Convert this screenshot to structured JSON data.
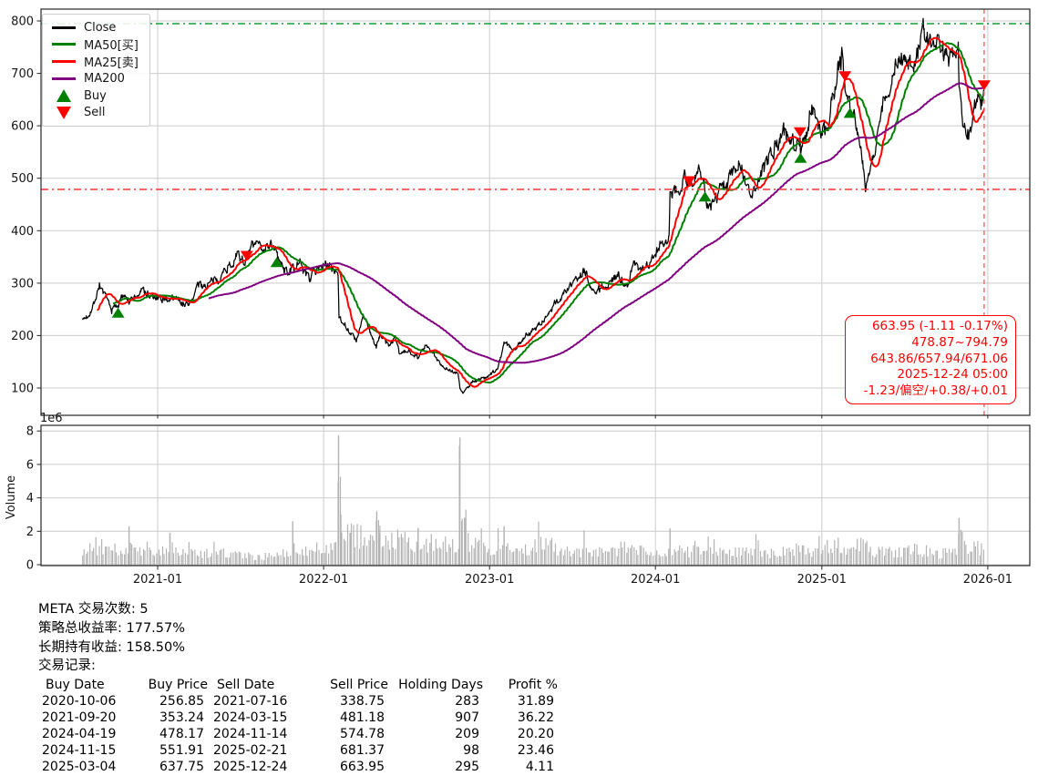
{
  "legend": {
    "items": [
      {
        "label": "Close",
        "type": "line",
        "color": "#000000"
      },
      {
        "label": "MA50[买]",
        "type": "line",
        "color": "#008000"
      },
      {
        "label": "MA25[卖]",
        "type": "line",
        "color": "#ff0000"
      },
      {
        "label": "MA200",
        "type": "line",
        "color": "#800080"
      },
      {
        "label": "Buy",
        "type": "triangle-up",
        "color": "#008000"
      },
      {
        "label": "Sell",
        "type": "triangle-down",
        "color": "#ff0000"
      }
    ]
  },
  "annotation": {
    "color": "#ff0000",
    "lines": [
      "663.95 (-1.11 -0.17%)",
      "478.87~794.79",
      "643.86/657.94/671.06",
      "2025-12-24 05:00",
      "-1.23/偏空/+0.38/+0.01"
    ]
  },
  "footer": {
    "stats": [
      "META 交易次数: 5",
      "策略总收益率: 177.57%",
      "长期持有收益: 158.50%",
      "交易记录:"
    ],
    "table": {
      "headers": [
        "Buy Date",
        "Buy Price",
        "Sell Date",
        "Sell Price",
        "Holding Days",
        "Profit %"
      ],
      "rows": [
        [
          "2020-10-06",
          "256.85",
          "2021-07-16",
          "338.75",
          "283",
          "31.89"
        ],
        [
          "2021-09-20",
          "353.24",
          "2024-03-15",
          "481.18",
          "907",
          "36.22"
        ],
        [
          "2024-04-19",
          "478.17",
          "2024-11-14",
          "574.78",
          "209",
          "20.20"
        ],
        [
          "2024-11-15",
          "551.91",
          "2025-02-21",
          "681.37",
          "98",
          "23.46"
        ],
        [
          "2025-03-04",
          "637.75",
          "2025-12-24",
          "663.95",
          "295",
          "4.11"
        ]
      ]
    }
  },
  "chart_data": {
    "type": "line",
    "title": "",
    "xlabel": "",
    "ylabel": "",
    "volume_axis_label": "Volume",
    "volume_offset_label": "1e6",
    "ylim": [
      48,
      823
    ],
    "volume_ylim": [
      0,
      8000000
    ],
    "xlim": [
      "2020-04-20",
      "2026-04-03"
    ],
    "grid": true,
    "legend_position": "upper left",
    "grid_color": "#cccccc",
    "x_ticks": [
      {
        "label": "2021-01",
        "date": "2021-01-01"
      },
      {
        "label": "2022-01",
        "date": "2022-01-01"
      },
      {
        "label": "2023-01",
        "date": "2023-01-01"
      },
      {
        "label": "2024-01",
        "date": "2024-01-01"
      },
      {
        "label": "2025-01",
        "date": "2025-01-01"
      },
      {
        "label": "2026-01",
        "date": "2026-01-01"
      }
    ],
    "price_ticks": [
      100,
      200,
      300,
      400,
      500,
      600,
      700,
      800
    ],
    "volume_ticks": [
      0,
      2,
      4,
      6,
      8
    ],
    "reference_lines": {
      "high": {
        "value": 794.79,
        "color": "#10a037",
        "style": "dashdot"
      },
      "low": {
        "value": 478.87,
        "color": "#ff4040",
        "style": "dashdot"
      },
      "current_date": {
        "value": "2025-12-24",
        "color": "#ff6060",
        "style": "dashed"
      }
    },
    "markers": {
      "buys": [
        {
          "date": "2020-10-06",
          "price": 256.85
        },
        {
          "date": "2021-09-20",
          "price": 353.24
        },
        {
          "date": "2024-04-19",
          "price": 478.17
        },
        {
          "date": "2024-11-15",
          "price": 551.91
        },
        {
          "date": "2025-03-04",
          "price": 637.75
        }
      ],
      "sells": [
        {
          "date": "2021-07-16",
          "price": 338.75
        },
        {
          "date": "2024-03-15",
          "price": 481.18
        },
        {
          "date": "2024-11-14",
          "price": 574.78
        },
        {
          "date": "2025-02-21",
          "price": 681.37
        },
        {
          "date": "2025-12-24",
          "price": 663.95
        }
      ]
    },
    "series": {
      "close": {
        "name": "Close",
        "color": "#000000",
        "points": [
          [
            "2020-07-20",
            230
          ],
          [
            "2020-07-31",
            238
          ],
          [
            "2020-08-14",
            262
          ],
          [
            "2020-08-26",
            299
          ],
          [
            "2020-09-04",
            282
          ],
          [
            "2020-09-21",
            248
          ],
          [
            "2020-10-06",
            259
          ],
          [
            "2020-10-23",
            284
          ],
          [
            "2020-10-30",
            263
          ],
          [
            "2020-11-16",
            276
          ],
          [
            "2020-12-01",
            286
          ],
          [
            "2020-12-18",
            272
          ],
          [
            "2021-01-08",
            268
          ],
          [
            "2021-01-27",
            272
          ],
          [
            "2021-02-17",
            269
          ],
          [
            "2021-03-08",
            254
          ],
          [
            "2021-03-31",
            295
          ],
          [
            "2021-04-22",
            298
          ],
          [
            "2021-05-12",
            305
          ],
          [
            "2021-06-01",
            328
          ],
          [
            "2021-06-28",
            352
          ],
          [
            "2021-07-16",
            341
          ],
          [
            "2021-07-27",
            372
          ],
          [
            "2021-08-27",
            370
          ],
          [
            "2021-09-07",
            380
          ],
          [
            "2021-09-20",
            353
          ],
          [
            "2021-10-04",
            326
          ],
          [
            "2021-10-22",
            324
          ],
          [
            "2021-11-09",
            337
          ],
          [
            "2021-12-01",
            311
          ],
          [
            "2021-12-23",
            334
          ],
          [
            "2022-01-14",
            332
          ],
          [
            "2022-02-02",
            323
          ],
          [
            "2022-02-04",
            238
          ],
          [
            "2022-02-25",
            211
          ],
          [
            "2022-03-14",
            188
          ],
          [
            "2022-03-29",
            234
          ],
          [
            "2022-04-08",
            222
          ],
          [
            "2022-04-27",
            175
          ],
          [
            "2022-05-06",
            204
          ],
          [
            "2022-05-24",
            181
          ],
          [
            "2022-06-08",
            196
          ],
          [
            "2022-06-17",
            163
          ],
          [
            "2022-07-08",
            171
          ],
          [
            "2022-07-28",
            160
          ],
          [
            "2022-08-15",
            180
          ],
          [
            "2022-09-06",
            156
          ],
          [
            "2022-09-30",
            136
          ],
          [
            "2022-10-24",
            129
          ],
          [
            "2022-10-28",
            99
          ],
          [
            "2022-11-04",
            90
          ],
          [
            "2022-11-23",
            111
          ],
          [
            "2022-12-13",
            119
          ],
          [
            "2022-12-29",
            120
          ],
          [
            "2023-01-20",
            140
          ],
          [
            "2023-02-02",
            188
          ],
          [
            "2023-02-24",
            171
          ],
          [
            "2023-03-17",
            196
          ],
          [
            "2023-04-14",
            218
          ],
          [
            "2023-05-05",
            233
          ],
          [
            "2023-05-26",
            262
          ],
          [
            "2023-06-16",
            281
          ],
          [
            "2023-07-14",
            309
          ],
          [
            "2023-07-28",
            324
          ],
          [
            "2023-08-18",
            285
          ],
          [
            "2023-09-15",
            299
          ],
          [
            "2023-10-13",
            314
          ],
          [
            "2023-10-26",
            289
          ],
          [
            "2023-11-14",
            332
          ],
          [
            "2023-12-14",
            333
          ],
          [
            "2024-01-19",
            382
          ],
          [
            "2024-01-31",
            390
          ],
          [
            "2024-02-02",
            474
          ],
          [
            "2024-02-23",
            484
          ],
          [
            "2024-03-08",
            505
          ],
          [
            "2024-03-15",
            481
          ],
          [
            "2024-04-05",
            522
          ],
          [
            "2024-04-19",
            478
          ],
          [
            "2024-04-25",
            441
          ],
          [
            "2024-05-17",
            470
          ],
          [
            "2024-06-07",
            492
          ],
          [
            "2024-07-05",
            538
          ],
          [
            "2024-07-26",
            466
          ],
          [
            "2024-08-05",
            477
          ],
          [
            "2024-08-30",
            521
          ],
          [
            "2024-09-20",
            560
          ],
          [
            "2024-10-07",
            589
          ],
          [
            "2024-10-31",
            567
          ],
          [
            "2024-11-14",
            575
          ],
          [
            "2024-11-15",
            552
          ],
          [
            "2024-12-11",
            632
          ],
          [
            "2024-12-31",
            588
          ],
          [
            "2025-01-17",
            612
          ],
          [
            "2025-01-31",
            687
          ],
          [
            "2025-02-14",
            735
          ],
          [
            "2025-02-21",
            681
          ],
          [
            "2025-03-04",
            638
          ],
          [
            "2025-03-21",
            597
          ],
          [
            "2025-04-07",
            485
          ],
          [
            "2025-04-25",
            547
          ],
          [
            "2025-05-16",
            640
          ],
          [
            "2025-06-06",
            696
          ],
          [
            "2025-06-27",
            732
          ],
          [
            "2025-07-18",
            711
          ],
          [
            "2025-08-08",
            768
          ],
          [
            "2025-08-14",
            788
          ],
          [
            "2025-08-29",
            746
          ],
          [
            "2025-09-12",
            754
          ],
          [
            "2025-09-26",
            742
          ],
          [
            "2025-10-10",
            731
          ],
          [
            "2025-10-28",
            750
          ],
          [
            "2025-10-30",
            666
          ],
          [
            "2025-11-07",
            600
          ],
          [
            "2025-11-18",
            589
          ],
          [
            "2025-11-21",
            583
          ],
          [
            "2025-12-01",
            631
          ],
          [
            "2025-12-10",
            654
          ],
          [
            "2025-12-16",
            629
          ],
          [
            "2025-12-24",
            663.95
          ]
        ]
      },
      "ma25": {
        "name": "MA25[卖]",
        "color": "#ff0000",
        "window": 25
      },
      "ma50": {
        "name": "MA50[买]",
        "color": "#008000",
        "window": 50
      },
      "ma200": {
        "name": "MA200",
        "color": "#800080",
        "window": 200
      }
    },
    "volume": {
      "color": "#b3b3b3",
      "unit": 1000000,
      "points": [
        [
          "2020-07-20",
          0.9
        ],
        [
          "2020-09-04",
          1.2
        ],
        [
          "2020-10-15",
          0.8
        ],
        [
          "2020-10-28",
          0.9
        ],
        [
          "2020-10-30",
          2.3
        ],
        [
          "2020-11-03",
          1.0
        ],
        [
          "2020-12-15",
          0.9
        ],
        [
          "2021-01-26",
          0.9
        ],
        [
          "2021-01-28",
          1.9
        ],
        [
          "2021-02-02",
          1.0
        ],
        [
          "2021-03-15",
          0.8
        ],
        [
          "2021-05-15",
          0.7
        ],
        [
          "2021-07-01",
          0.6
        ],
        [
          "2021-08-15",
          0.5
        ],
        [
          "2021-10-22",
          0.7
        ],
        [
          "2021-10-25",
          2.6
        ],
        [
          "2021-10-28",
          1.0
        ],
        [
          "2021-12-01",
          0.9
        ],
        [
          "2022-01-15",
          1.3
        ],
        [
          "2022-02-01",
          1.6
        ],
        [
          "2022-02-03",
          7.75
        ],
        [
          "2022-02-08",
          3.0
        ],
        [
          "2022-03-01",
          1.9
        ],
        [
          "2022-04-26",
          1.6
        ],
        [
          "2022-04-28",
          3.2
        ],
        [
          "2022-05-03",
          1.9
        ],
        [
          "2022-06-10",
          1.6
        ],
        [
          "2022-07-26",
          1.4
        ],
        [
          "2022-07-28",
          2.2
        ],
        [
          "2022-08-03",
          1.5
        ],
        [
          "2022-09-15",
          1.3
        ],
        [
          "2022-10-25",
          1.5
        ],
        [
          "2022-10-27",
          7.1
        ],
        [
          "2022-11-01",
          2.6
        ],
        [
          "2022-11-09",
          2.8
        ],
        [
          "2022-11-15",
          1.6
        ],
        [
          "2022-12-20",
          1.1
        ],
        [
          "2023-01-31",
          1.1
        ],
        [
          "2023-02-02",
          2.3
        ],
        [
          "2023-02-07",
          1.2
        ],
        [
          "2023-03-20",
          0.9
        ],
        [
          "2023-04-27",
          1.5
        ],
        [
          "2023-06-15",
          0.8
        ],
        [
          "2023-07-25",
          0.9
        ],
        [
          "2023-07-27",
          1.7
        ],
        [
          "2023-08-01",
          0.9
        ],
        [
          "2023-09-20",
          0.7
        ],
        [
          "2023-10-26",
          1.2
        ],
        [
          "2023-12-15",
          0.7
        ],
        [
          "2024-01-31",
          0.8
        ],
        [
          "2024-02-02",
          2.1
        ],
        [
          "2024-02-07",
          0.9
        ],
        [
          "2024-03-20",
          0.8
        ],
        [
          "2024-04-25",
          1.5
        ],
        [
          "2024-05-01",
          0.8
        ],
        [
          "2024-06-15",
          0.7
        ],
        [
          "2024-08-01",
          1.1
        ],
        [
          "2024-09-15",
          0.7
        ],
        [
          "2024-10-31",
          1.0
        ],
        [
          "2024-12-15",
          0.7
        ],
        [
          "2025-01-30",
          1.4
        ],
        [
          "2025-03-15",
          0.8
        ],
        [
          "2025-04-08",
          1.6
        ],
        [
          "2025-04-20",
          0.9
        ],
        [
          "2025-05-30",
          0.8
        ],
        [
          "2025-07-31",
          1.0
        ],
        [
          "2025-09-15",
          0.7
        ],
        [
          "2025-10-28",
          1.0
        ],
        [
          "2025-10-30",
          2.8
        ],
        [
          "2025-11-05",
          1.7
        ],
        [
          "2025-11-20",
          1.2
        ],
        [
          "2025-12-24",
          1.0
        ]
      ]
    }
  }
}
